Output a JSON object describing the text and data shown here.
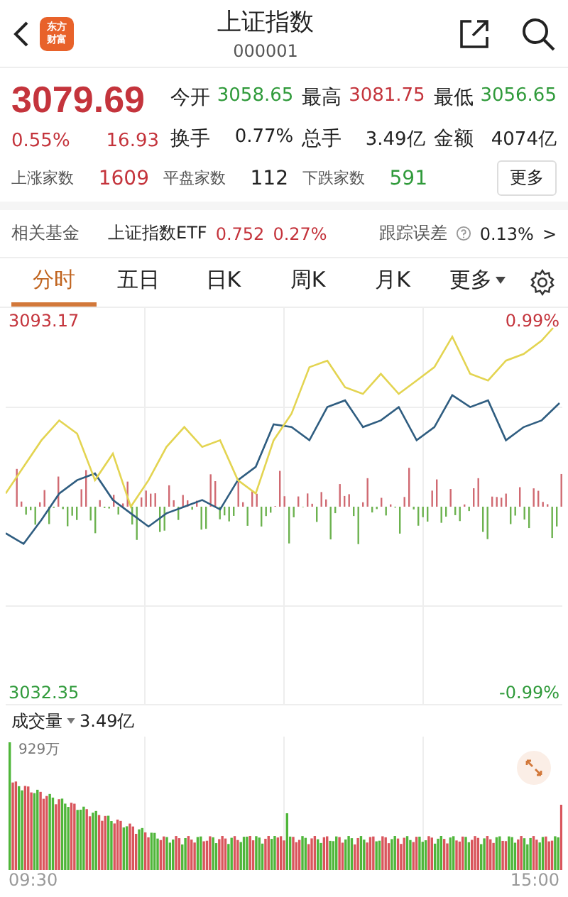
{
  "header": {
    "logo_text": "东方财富",
    "title": "上证指数",
    "code": "000001"
  },
  "quote": {
    "price": "3079.69",
    "change_pct": "0.55%",
    "change": "16.93",
    "color": "#c4343c",
    "stats": [
      {
        "label": "今开",
        "value": "3058.65",
        "color": "#2f9a3a"
      },
      {
        "label": "最高",
        "value": "3081.75",
        "color": "#c4343c"
      },
      {
        "label": "最低",
        "value": "3056.65",
        "color": "#2f9a3a"
      },
      {
        "label": "换手",
        "value": "0.77%",
        "color": "#222222"
      },
      {
        "label": "总手",
        "value": "3.49亿",
        "color": "#222222"
      },
      {
        "label": "金额",
        "value": "4074亿",
        "color": "#222222"
      }
    ],
    "breadth": [
      {
        "label": "上涨家数",
        "value": "1609",
        "color": "#c4343c"
      },
      {
        "label": "平盘家数",
        "value": "112",
        "color": "#222222"
      },
      {
        "label": "下跌家数",
        "value": "591",
        "color": "#2f9a3a"
      }
    ],
    "more_button": "更多"
  },
  "fund": {
    "label": "相关基金",
    "name": "上证指数ETF",
    "price": "0.752",
    "change_pct": "0.27%",
    "color": "#c4343c",
    "error_label": "跟踪误差",
    "error_value": "0.13%",
    "arrow": ">"
  },
  "tabs": [
    {
      "label": "分时",
      "selected": true,
      "dropdown": false
    },
    {
      "label": "五日",
      "selected": false,
      "dropdown": false
    },
    {
      "label": "日K",
      "selected": false,
      "dropdown": false
    },
    {
      "label": "周K",
      "selected": false,
      "dropdown": false
    },
    {
      "label": "月K",
      "selected": false,
      "dropdown": false
    },
    {
      "label": "更多",
      "selected": false,
      "dropdown": true
    }
  ],
  "price_chart": {
    "right_top_label": "0.99%",
    "right_bottom_label": "-0.99%",
    "chart_data": {
      "type": "line",
      "ylim": [
        3032.35,
        3093.17
      ],
      "yticks": [
        {
          "value": 3093.17,
          "label": "3093.17"
        },
        {
          "value": 3032.35,
          "label": "3032.35"
        }
      ],
      "series": [
        {
          "color": "#2f5d80",
          "values": [
            3058.42,
            3056.68,
            3060.59,
            3064.93,
            3067.11,
            3068.19,
            3063.85,
            3061.68,
            3059.5,
            3061.68,
            3062.76,
            3063.85,
            3062.33,
            3067.11,
            3069.28,
            3076.23,
            3075.79,
            3073.62,
            3079.05,
            3080.14,
            3075.79,
            3076.88,
            3079.05,
            3073.62,
            3075.79,
            3081.01,
            3079.05,
            3080.14,
            3073.62,
            3075.79,
            3076.88,
            3079.7
          ]
        },
        {
          "color": "#e3d451",
          "values": [
            3064.93,
            3069.28,
            3073.62,
            3076.88,
            3074.71,
            3067.11,
            3071.45,
            3062.76,
            3067.11,
            3072.54,
            3075.79,
            3072.54,
            3073.62,
            3067.11,
            3064.93,
            3073.62,
            3077.97,
            3085.57,
            3086.65,
            3082.31,
            3081.22,
            3084.48,
            3081.22,
            3083.4,
            3085.57,
            3090.56,
            3084.48,
            3083.4,
            3086.65,
            3087.74,
            3089.91,
            3093.17
          ]
        }
      ]
    }
  },
  "volume": {
    "label": "成交量",
    "value": "3.49亿",
    "max_label": "929万",
    "start_time": "09:30",
    "end_time": "15:00"
  }
}
